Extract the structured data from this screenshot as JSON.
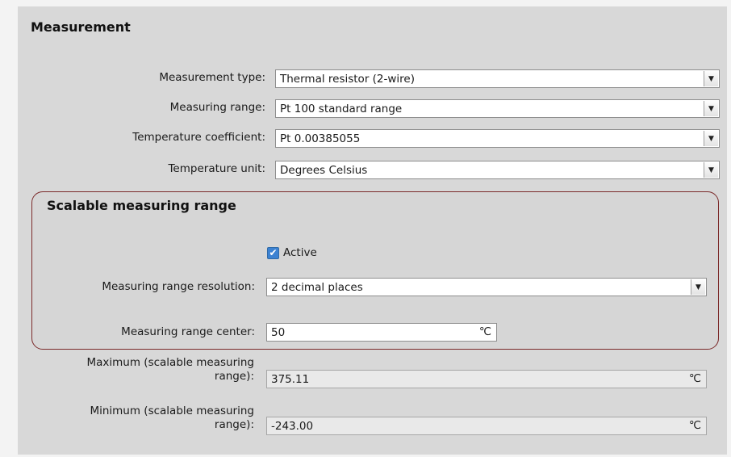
{
  "section": {
    "title": "Measurement"
  },
  "measurement_type": {
    "label": "Measurement type:",
    "value": "Thermal resistor (2-wire)"
  },
  "measuring_range": {
    "label": "Measuring range:",
    "value": "Pt 100 standard range"
  },
  "temperature_coefficient": {
    "label": "Temperature coefficient:",
    "value": "Pt 0.00385055"
  },
  "temperature_unit": {
    "label": "Temperature unit:",
    "value": "Degrees Celsius"
  },
  "scalable": {
    "title": "Scalable measuring range",
    "active_label": "Active",
    "active_checked": true,
    "resolution": {
      "label": "Measuring range resolution:",
      "value": "2 decimal places"
    },
    "center": {
      "label": "Measuring range center:",
      "value": "50",
      "unit": "℃"
    }
  },
  "maximum": {
    "label": "Maximum (scalable measuring range):",
    "value": "375.11",
    "unit": "℃"
  },
  "minimum": {
    "label": "Minimum (scalable measuring range):",
    "value": "-243.00",
    "unit": "℃"
  },
  "icons": {
    "dropdown": "dropdown-arrow-icon",
    "check": "checkmark-icon"
  },
  "colors": {
    "panel_bg": "#d8d8d8",
    "highlight_border": "#7b2a2a",
    "checkbox": "#3c82d2"
  }
}
